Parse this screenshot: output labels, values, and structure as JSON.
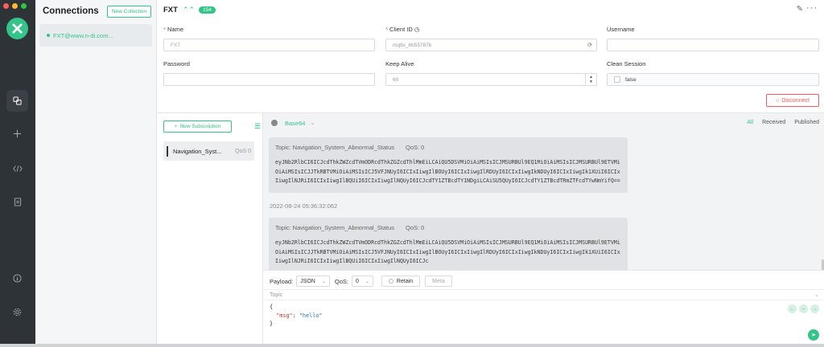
{
  "sidebar": {
    "title": "Connections",
    "new_collection": "New Collection",
    "connection_item": "FXT@www.n-di.com...",
    "rail_icons": [
      "connections-icon",
      "add-icon",
      "script-icon",
      "log-icon",
      "about-icon",
      "settings-icon"
    ]
  },
  "header": {
    "name": "FXT",
    "count": "154"
  },
  "form": {
    "name_label": "Name",
    "name_placeholder": "FXT",
    "client_id_label": "Client ID",
    "client_id_value": "mqttx_6b55787b",
    "username_label": "Username",
    "password_label": "Password",
    "keep_alive_label": "Keep Alive",
    "keep_alive_value": "60",
    "clean_session_label": "Clean Session",
    "clean_session_value": "false",
    "disconnect": "Disconnect"
  },
  "subscriptions": {
    "new_subscription": "New Subscription",
    "items": [
      {
        "topic": "Navigation_Syst...",
        "qos": "QoS 0"
      }
    ]
  },
  "messages": {
    "format": "Base64",
    "filters": {
      "all": "All",
      "received": "Received",
      "published": "Published"
    },
    "list": [
      {
        "topic": "Topic: Navigation_System_Abnormal_Status",
        "qos": "QoS: 0",
        "body": "eyJNb2RlbCI6ICJcdThkZWZcdTVmODRcdThkZGZcdThlMmEiLCAiQU5DSVMiOiAiMSIsICJMSURBUl9EQ1MiOiAiMSIsICJMSURBUl9ETVMiOiAiMSIsICJJTkRBTVMiOiAiMSIsICJ5VFJNUyI6ICIxIiwgIlBOUyI6ICIxIiwgIlRDUyI6ICIxIiwgIkNDUyI6ICIxIiwgIk1XUiI6ICIxIiwgIlNJRiI6ICIxIiwgIlBQUiI6ICIxIiwgIlNQUyI6ICJcdTY1ZTBcdTY1NDgiLCAiSU5QUyI6ICJcdTY1ZTBcdTRmZTFcdTYwNmYifQ==",
        "time": "2022-08-24 05:36:32:062"
      },
      {
        "topic": "Topic: Navigation_System_Abnormal_Status",
        "qos": "QoS: 0",
        "body": "eyJNb2RlbCI6ICJcdThkZWZcdTVmODRcdThkZGZcdThlMmEiLCAiQU5DSVMiOiAiMSIsICJMSURBUl9EQ1MiOiAiMSIsICJMSURBUl9ETVMiOiAiMSIsICJJTkRBTVMiOiAiMSIsICJ5VFJNUyI6ICIxIiwgIlBOUyI6ICIxIiwgIlRDUyI6ICIxIiwgIkNDUyI6ICIxIiwgIk1XUiI6ICIxIiwgIlNJRiI6ICIxIiwgIlBQUiI6ICIxIiwgIlNQUyI6ICJc"
      }
    ]
  },
  "publish": {
    "payload_label": "Payload:",
    "payload_format": "JSON",
    "qos_label": "QoS:",
    "qos_value": "0",
    "retain": "Retain",
    "meta": "Meta",
    "topic_placeholder": "Topic",
    "code_line1": "{",
    "code_key": "\"msg\"",
    "code_colon": ": ",
    "code_value": "\"hello\"",
    "code_line3": "}"
  },
  "colors": {
    "accent": "#34c388",
    "danger": "#f05a5a",
    "rail": "#2e3338"
  }
}
